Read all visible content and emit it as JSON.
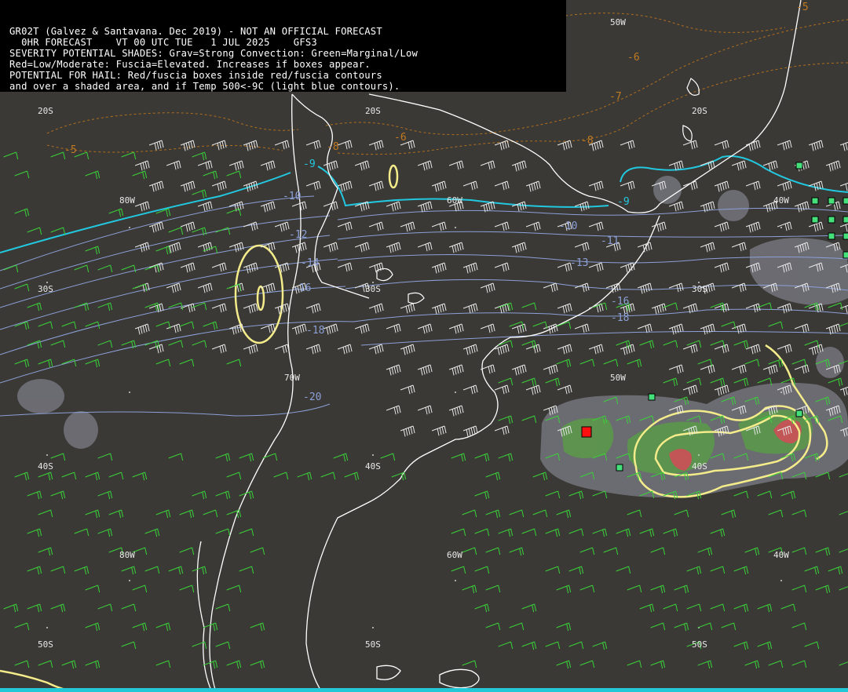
{
  "header": {
    "line1": "GR02T (Galvez & Santavana. Dec 2019) - NOT AN OFFICIAL FORECAST",
    "line2": "  0HR FORECAST    VT 00 UTC TUE   1 JUL 2025    GFS3",
    "line3": "SEVERITY POTENTIAL SHADES: Grav=Strong Convection: Green=Marginal/Low",
    "line4": "Red=Low/Moderate: Fuscia=Elevated. Increases if boxes appear.",
    "line5": "POTENTIAL FOR HAIL: Red/fuscia boxes inside red/fuscia contours",
    "line6": "and over a shaded area, and if Temp 500<-9C (light blue contours)."
  },
  "grid_labels": {
    "lat_20s_a": "20S",
    "lat_20s_b": "20S",
    "lat_20s_c": "20S",
    "lat_30s_a": "30S",
    "lat_30s_b": "30S",
    "lat_30s_c": "30S",
    "lat_40s_a": "40S",
    "lat_40s_b": "40S",
    "lat_40s_c": "40S",
    "lat_50s_a": "50S",
    "lat_50s_b": "50S",
    "lat_50s_c": "50S",
    "lon_80w_a": "80W",
    "lon_80w_b": "80W",
    "lon_60w_a": "60W",
    "lon_60w_b": "60W",
    "lon_40w_a": "40W",
    "lon_40w_b": "40W",
    "lon_50w_a": "50W",
    "lon_50w_b": "50W",
    "lon_70w": "70W"
  },
  "temp_labels": {
    "m9_a": "-9",
    "m9_b": "-9",
    "m5_a": "-5",
    "m5_b": "-5",
    "m6_a": "-6",
    "m6_b": "-6",
    "m7": "-7",
    "m8_a": "-8",
    "m8_b": "-8",
    "m10_a": "-10",
    "m10_b": "-10",
    "m11": "-11",
    "m12": "-12",
    "m13": "-13",
    "m14": "-14",
    "m16_a": "-16",
    "m16_b": "-16",
    "m18_a": "-18",
    "m18_b": "-18",
    "m20": "-20"
  },
  "colors": {
    "background": "#3a3935",
    "coast": "#ffffff",
    "temp_minus9": "#22c8e0",
    "temp_cold": "#8ca0d8",
    "temp_warm": "#c07a22",
    "shade_gray": "#77777f",
    "shade_green": "#5a9a48",
    "shade_red": "#c05050",
    "hail_contour": "#f4ec8a",
    "wind_white": "#e8e8e8",
    "wind_green": "#3ad23a",
    "box_green": "#44e07a",
    "box_red": "#ff1010"
  }
}
